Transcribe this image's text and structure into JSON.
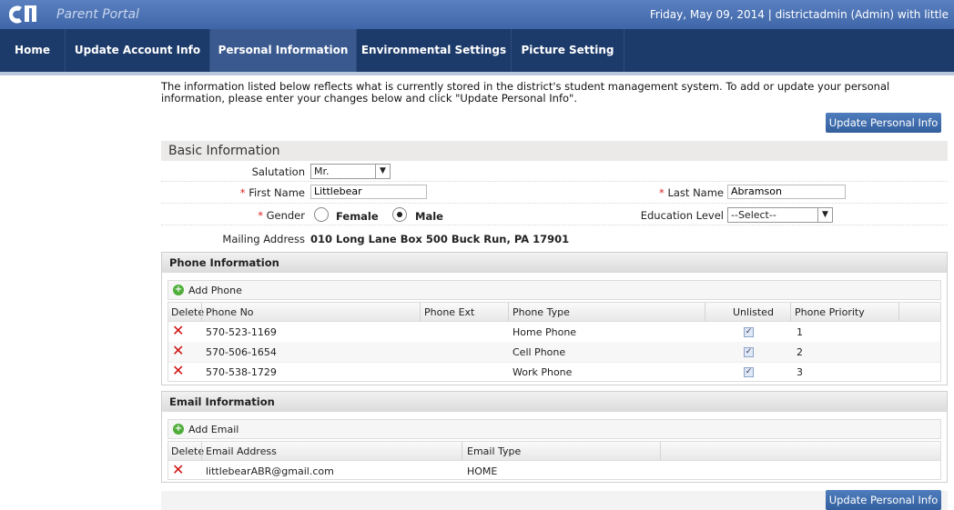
{
  "header": {
    "portal_title": "Parent Portal",
    "user_info": "Friday, May 09, 2014  |  districtadmin (Admin) with little"
  },
  "nav": {
    "items": [
      {
        "label": "Home"
      },
      {
        "label": "Update Account Info"
      },
      {
        "label": "Personal Information"
      },
      {
        "label": "Environmental Settings"
      },
      {
        "label": "Picture Setting"
      }
    ],
    "active": "Personal Information"
  },
  "intro_text": "The information listed below reflects what is currently stored in the district's student management system. To add or update your personal information, please enter your changes below and click \"Update Personal Info\".",
  "update_button_label": "Update Personal Info",
  "basic": {
    "title": "Basic Information",
    "salutation_label": "Salutation",
    "salutation_value": "Mr.",
    "first_name_label": "First Name",
    "first_name_value": "Littlebear",
    "last_name_label": "Last Name",
    "last_name_value": "Abramson",
    "required_mark": "*",
    "gender_label": "Gender",
    "gender_female": "Female",
    "gender_male": "Male",
    "gender_selected": "Male",
    "education_label": "Education Level",
    "education_value": "--Select--",
    "mailing_label": "Mailing Address",
    "mailing_value": "010 Long Lane Box 500 Buck Run, PA 17901"
  },
  "phone": {
    "title": "Phone Information",
    "add_label": "Add Phone",
    "columns": [
      "Delete",
      "Phone No",
      "Phone Ext",
      "Phone Type",
      "Unlisted",
      "Phone Priority"
    ],
    "rows": [
      {
        "number": "570-523-1169",
        "ext": "",
        "type": "Home Phone",
        "unlisted": true,
        "priority": "1"
      },
      {
        "number": "570-506-1654",
        "ext": "",
        "type": "Cell Phone",
        "unlisted": true,
        "priority": "2"
      },
      {
        "number": "570-538-1729",
        "ext": "",
        "type": "Work Phone",
        "unlisted": true,
        "priority": "3"
      }
    ]
  },
  "email": {
    "title": "Email Information",
    "add_label": "Add Email",
    "columns": [
      "Delete",
      "Email Address",
      "Email Type"
    ],
    "rows": [
      {
        "address": "littlebearABR@gmail.com",
        "type": "HOME"
      }
    ]
  },
  "colors": {
    "topbar": "#4a6fb0",
    "navbar": "#1d3b6a",
    "accent_button": "#3c6aab",
    "delete_icon": "#d01010"
  }
}
